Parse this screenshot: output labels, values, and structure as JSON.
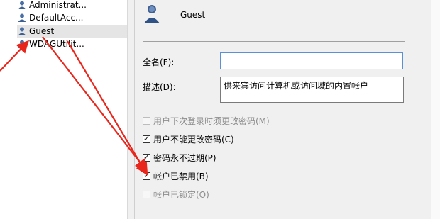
{
  "users_list": {
    "items": [
      {
        "label": "Administrat...",
        "selected": false
      },
      {
        "label": "DefaultAcc...",
        "selected": false
      },
      {
        "label": "Guest",
        "selected": true
      },
      {
        "label": "WDAGUtilit...",
        "selected": false
      }
    ]
  },
  "dialog": {
    "user_name": "Guest",
    "fullname_label": "全名(F):",
    "fullname_value": "",
    "description_label": "描述(D):",
    "description_value": "供来宾访问计算机或访问域的内置帐户",
    "checkboxes": [
      {
        "label": "用户下次登录时须更改密码(M)",
        "checked": false,
        "enabled": false
      },
      {
        "label": "用户不能更改密码(C)",
        "checked": true,
        "enabled": true
      },
      {
        "label": "密码永不过期(P)",
        "checked": true,
        "enabled": true
      },
      {
        "label": "帐户已禁用(B)",
        "checked": true,
        "enabled": true
      },
      {
        "label": "帐户已锁定(O)",
        "checked": false,
        "enabled": false
      }
    ]
  },
  "colors": {
    "annotation_arrow": "#e8261c",
    "selection": "#e5e5e5",
    "input_focus_border": "#5b8fd6"
  }
}
